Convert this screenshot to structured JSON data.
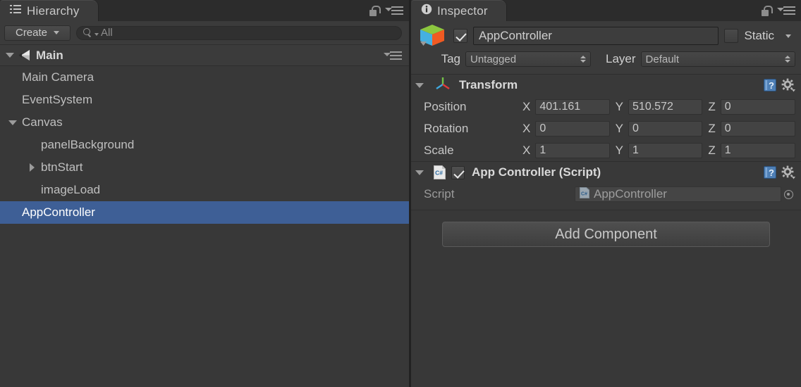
{
  "hierarchy": {
    "tab_label": "Hierarchy",
    "tab_icon": "hierarchy-list-icon",
    "lock_icon": "lock-open-icon",
    "menu_icon": "panel-menu-icon",
    "toolbar": {
      "create_label": "Create",
      "create_caret_icon": "chevron-down-icon",
      "search_icon": "search-icon",
      "search_value": "All",
      "search_placeholder": "All"
    },
    "scene": {
      "name": "Main",
      "icon": "unity-scene-icon",
      "expanded": true,
      "menu_icon": "scene-menu-icon"
    },
    "items": [
      {
        "label": "Main Camera",
        "depth": 1,
        "foldout": "none",
        "selected": false
      },
      {
        "label": "EventSystem",
        "depth": 1,
        "foldout": "none",
        "selected": false
      },
      {
        "label": "Canvas",
        "depth": 1,
        "foldout": "open",
        "selected": false
      },
      {
        "label": "panelBackground",
        "depth": 2,
        "foldout": "none",
        "selected": false
      },
      {
        "label": "btnStart",
        "depth": 2,
        "foldout": "closed",
        "selected": false
      },
      {
        "label": "imageLoad",
        "depth": 2,
        "foldout": "none",
        "selected": false
      },
      {
        "label": "AppController",
        "depth": 1,
        "foldout": "none",
        "selected": true
      }
    ]
  },
  "inspector": {
    "tab_label": "Inspector",
    "tab_icon": "info-circle-icon",
    "lock_icon": "lock-open-icon",
    "menu_icon": "panel-menu-icon",
    "object": {
      "icon": "unity-gameobject-cube-icon",
      "enabled": true,
      "name": "AppController",
      "static_label": "Static",
      "static_checked": false,
      "static_caret_icon": "chevron-down-icon",
      "tag_label": "Tag",
      "tag_value": "Untagged",
      "layer_label": "Layer",
      "layer_value": "Default"
    },
    "components": [
      {
        "title": "Transform",
        "icon": "transform-axes-icon",
        "expanded": true,
        "has_enable_checkbox": false,
        "help_icon": "help-book-icon",
        "settings_icon": "gear-icon",
        "rows": [
          {
            "label": "Position",
            "axes": [
              "X",
              "Y",
              "Z"
            ],
            "values": [
              "401.161",
              "510.572",
              "0"
            ]
          },
          {
            "label": "Rotation",
            "axes": [
              "X",
              "Y",
              "Z"
            ],
            "values": [
              "0",
              "0",
              "0"
            ]
          },
          {
            "label": "Scale",
            "axes": [
              "X",
              "Y",
              "Z"
            ],
            "values": [
              "1",
              "1",
              "1"
            ]
          }
        ]
      },
      {
        "title": "App Controller (Script)",
        "icon": "csharp-script-icon",
        "expanded": true,
        "has_enable_checkbox": true,
        "enabled": true,
        "help_icon": "help-book-icon",
        "settings_icon": "gear-icon",
        "script_field": {
          "label": "Script",
          "value": "AppController",
          "value_icon": "csharp-script-icon",
          "picker_icon": "object-picker-icon"
        }
      }
    ],
    "add_component_label": "Add Component"
  },
  "colors": {
    "panel_bg": "#383838",
    "tabstrip_bg": "#2c2c2c",
    "selection_blue": "#3e5f96",
    "text_primary": "#cfcfcf",
    "text_dim": "#9a9a9a",
    "field_bg": "#434343"
  }
}
